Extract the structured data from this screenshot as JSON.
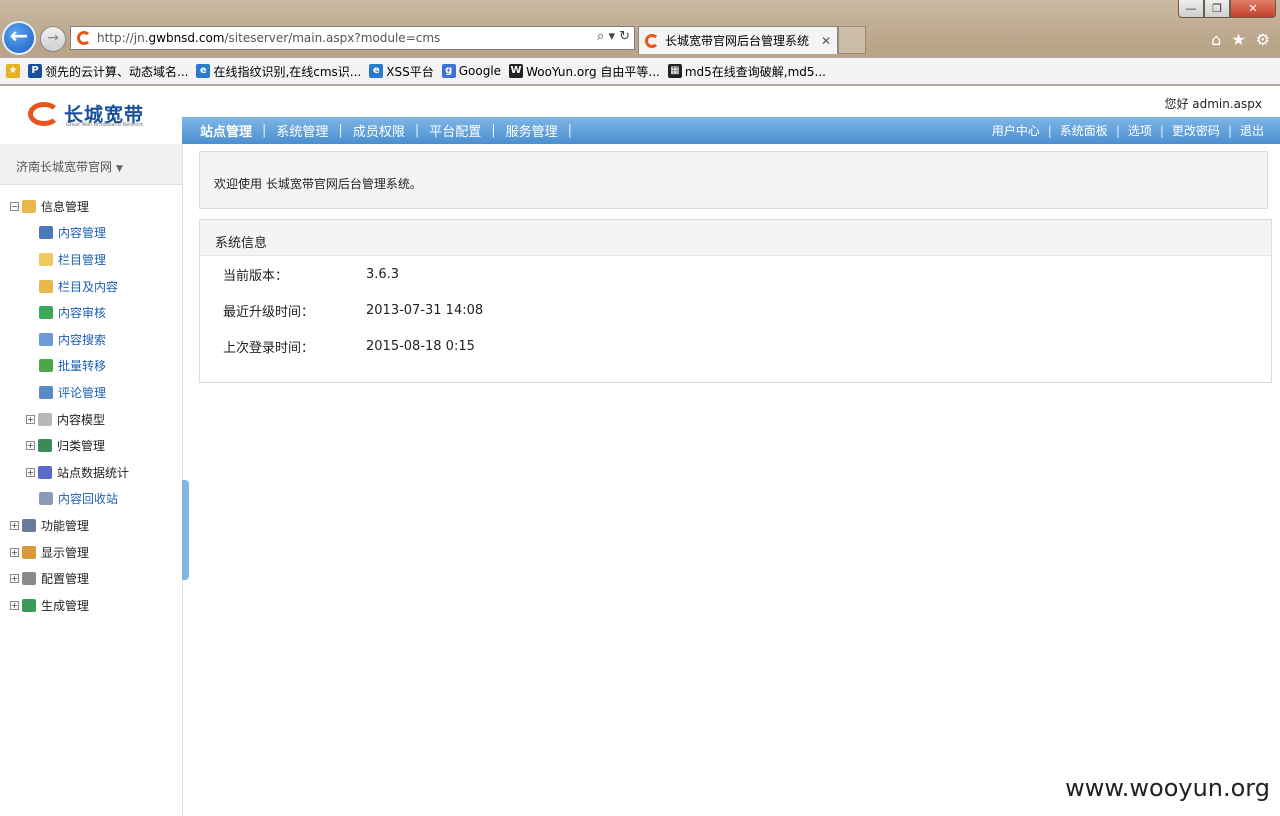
{
  "browser": {
    "url_prefix": "http://jn.",
    "url_host": "gwbnsd.com",
    "url_path": "/siteserver/main.aspx?module=cms",
    "tab_title": "长城宽带官网后台管理系统",
    "favorites": [
      {
        "icon": "star-icon",
        "label": ""
      },
      {
        "icon": "p-icon",
        "label": "领先的云计算、动态域名..."
      },
      {
        "icon": "ie-icon",
        "label": "在线指纹识别,在线cms识..."
      },
      {
        "icon": "ie-icon",
        "label": "XSS平台"
      },
      {
        "icon": "google-icon",
        "label": "Google"
      },
      {
        "icon": "wooyun-icon",
        "label": "WooYun.org  自由平等..."
      },
      {
        "icon": "grid-icon",
        "label": "md5在线查询破解,md5..."
      }
    ]
  },
  "header": {
    "logo_text": "长城宽带",
    "logo_sub": "Great Wall Broadband Network",
    "greeting": "您好 admin.aspx"
  },
  "topnav": {
    "left": [
      "站点管理",
      "系统管理",
      "成员权限",
      "平台配置",
      "服务管理"
    ],
    "right": [
      "用户中心",
      "系统面板",
      "选项",
      "更改密码",
      "退出"
    ]
  },
  "sidebar": {
    "site_selector": "济南长城宽带官网",
    "tree": [
      {
        "label": "信息管理",
        "level": 0,
        "expand": "minus",
        "color": "#e8b84a"
      },
      {
        "label": "内容管理",
        "level": 1,
        "leaf": true,
        "color": "#4a78b8"
      },
      {
        "label": "栏目管理",
        "level": 1,
        "leaf": true,
        "color": "#f0c860"
      },
      {
        "label": "栏目及内容",
        "level": 1,
        "leaf": true,
        "color": "#e8b84a"
      },
      {
        "label": "内容审核",
        "level": 1,
        "leaf": true,
        "color": "#3ca85a"
      },
      {
        "label": "内容搜索",
        "level": 1,
        "leaf": true,
        "color": "#6a9ad8"
      },
      {
        "label": "批量转移",
        "level": 1,
        "leaf": true,
        "color": "#4aa84a"
      },
      {
        "label": "评论管理",
        "level": 1,
        "leaf": true,
        "color": "#5a8ac8"
      },
      {
        "label": "内容模型",
        "level": 1,
        "expand": "plus",
        "color": "#b8b8b8"
      },
      {
        "label": "归类管理",
        "level": 1,
        "expand": "plus",
        "color": "#3c8a5a"
      },
      {
        "label": "站点数据统计",
        "level": 1,
        "expand": "plus",
        "color": "#5a6ac8"
      },
      {
        "label": "内容回收站",
        "level": 1,
        "leaf": true,
        "color": "#8a9ab8"
      },
      {
        "label": "功能管理",
        "level": 0,
        "expand": "plus",
        "color": "#6a7a9a"
      },
      {
        "label": "显示管理",
        "level": 0,
        "expand": "plus",
        "color": "#d89a3a"
      },
      {
        "label": "配置管理",
        "level": 0,
        "expand": "plus",
        "color": "#8a8a8a"
      },
      {
        "label": "生成管理",
        "level": 0,
        "expand": "plus",
        "color": "#3a9a5a"
      }
    ]
  },
  "main": {
    "welcome": "欢迎使用 长城宽带官网后台管理系统。",
    "panel_title": "系统信息",
    "info": [
      {
        "label": "当前版本：",
        "value": "3.6.3"
      },
      {
        "label": "最近升级时间：",
        "value": "2013-07-31 14:08"
      },
      {
        "label": "上次登录时间：",
        "value": "2015-08-18 0:15"
      }
    ]
  },
  "watermark": "www.wooyun.org"
}
